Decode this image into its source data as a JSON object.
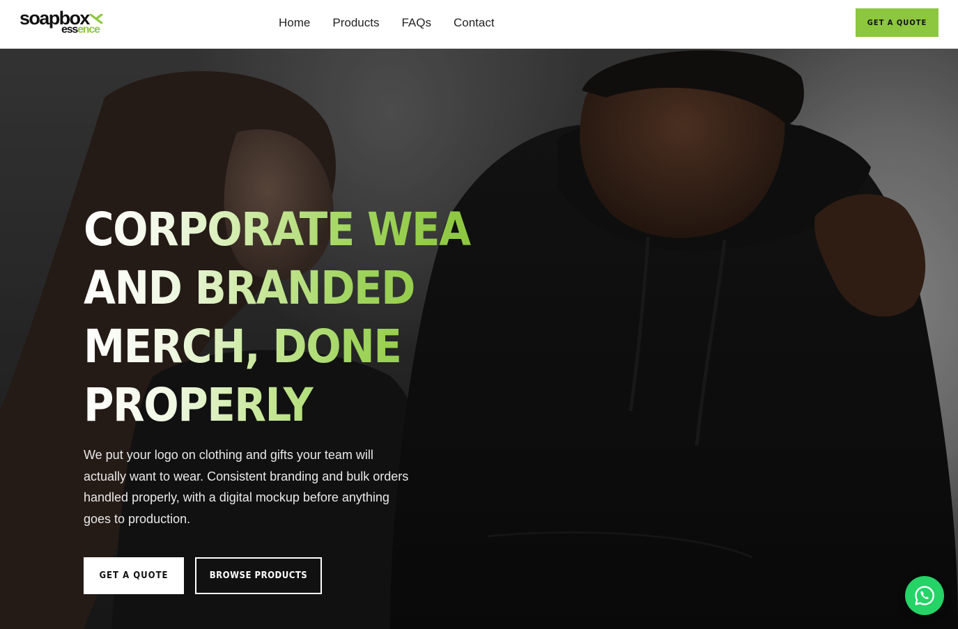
{
  "header": {
    "logo": {
      "top": "soapbox",
      "bottom_dark": "ess",
      "bottom_green": "ence"
    },
    "nav": [
      {
        "label": "Home"
      },
      {
        "label": "Products"
      },
      {
        "label": "FAQs"
      },
      {
        "label": "Contact"
      }
    ],
    "cta_label": "GET A QUOTE"
  },
  "hero": {
    "headline_lines": [
      "CORPORATE WEAR",
      "AND BRANDED",
      "MERCH, DONE",
      "PROPERLY"
    ],
    "subtext": "We put your logo on clothing and gifts your team will actually want to wear. Consistent branding and bulk orders handled properly, with a digital mockup before anything goes to production.",
    "primary_button": "GET A QUOTE",
    "secondary_button": "BROWSE PRODUCTS"
  },
  "icons": {
    "whatsapp": "whatsapp-icon",
    "logo_mark": "logo-x-icon"
  },
  "colors": {
    "accent": "#8dc63f",
    "whatsapp": "#25d366",
    "header_bg": "#ffffff",
    "hero_dark": "#1c1c1c"
  }
}
